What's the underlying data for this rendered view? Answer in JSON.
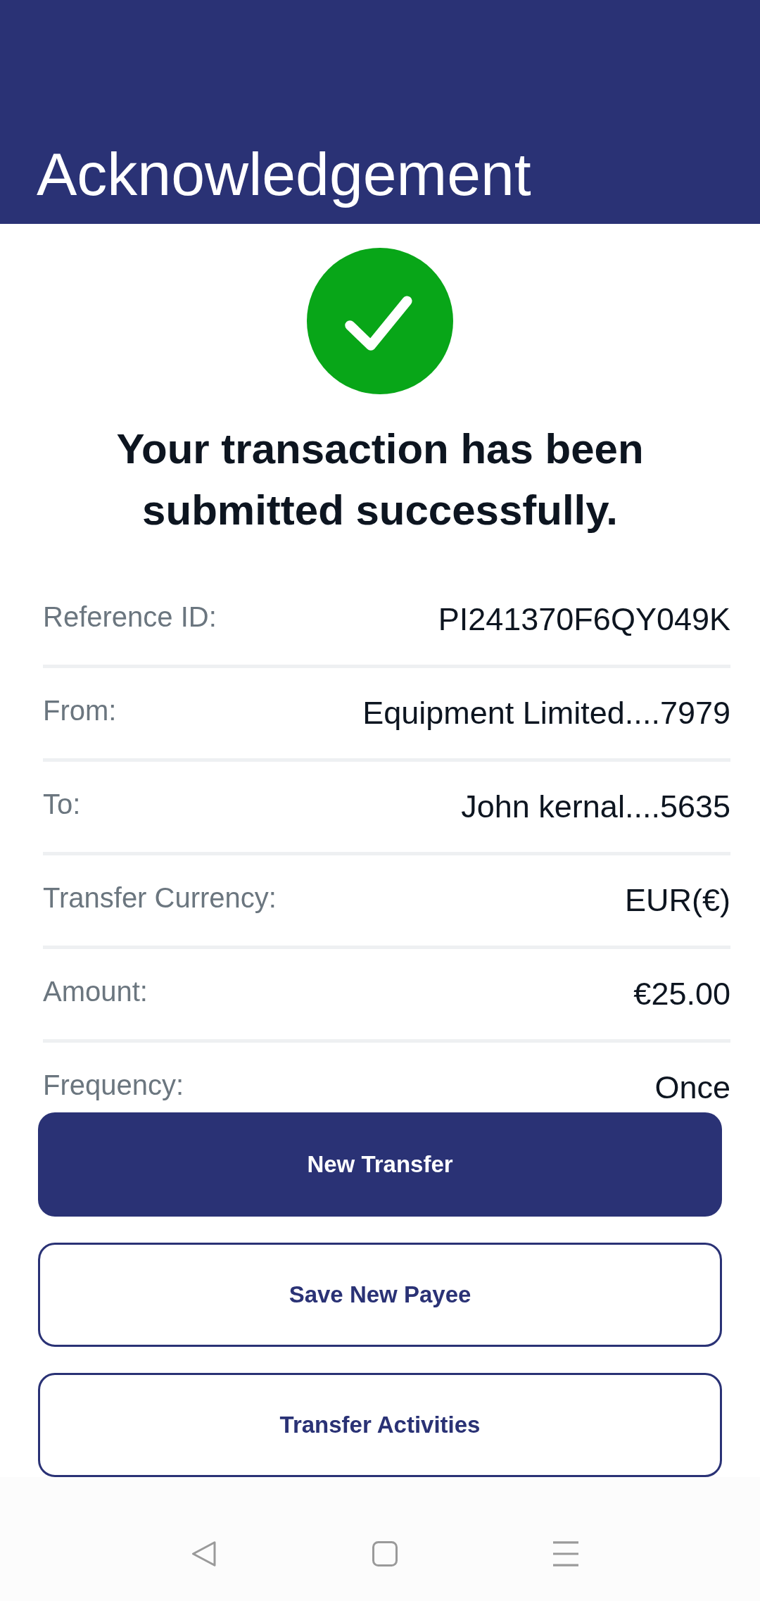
{
  "header": {
    "title": "Acknowledgement"
  },
  "status": {
    "kind": "success",
    "message": "Your transaction has been submitted successfully."
  },
  "details": [
    {
      "label": "Reference ID:",
      "value": "PI241370F6QY049K"
    },
    {
      "label": "From:",
      "value": "Equipment Limited....7979"
    },
    {
      "label": "To:",
      "value": "John kernal....5635"
    },
    {
      "label": "Transfer Currency:",
      "value": "EUR(€)"
    },
    {
      "label": "Amount:",
      "value": "€25.00"
    },
    {
      "label": "Frequency:",
      "value": "Once"
    }
  ],
  "actions": [
    {
      "label": "New Transfer",
      "kind": "primary"
    },
    {
      "label": "Save New Payee",
      "kind": "outline"
    },
    {
      "label": "Transfer Activities",
      "kind": "outline"
    }
  ]
}
